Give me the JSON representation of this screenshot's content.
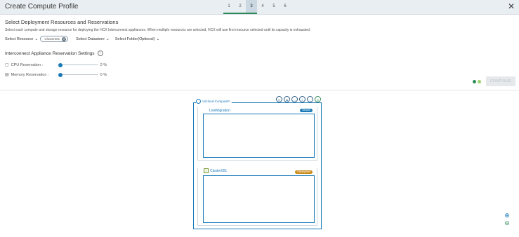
{
  "header": {
    "title": "Create Compute Profile",
    "steps": [
      "1",
      "2",
      "3",
      "4",
      "5",
      "6"
    ],
    "active_step": "3",
    "close_icon": "close-icon"
  },
  "main": {
    "section_title": "Select Deployment Resources and Reservations",
    "description": "Select each compute and storage resource for deploying the HCX Interconnect appliances. When multiple resources are selected, HCX will use first resource selected until its capacity is exhausted.",
    "select_resource_label": "Select Resource",
    "resource_pill": "Cluster001",
    "select_datastore_label": "Select Datastore",
    "select_folder_label": "Select Folder(Optional)"
  },
  "reservation": {
    "title": "Interconnect Appliance Reservation Settings",
    "cpu_label": "CPU Reservation :",
    "cpu_value": "0 %",
    "cpu_level": 0,
    "memory_label": "Memory Reservation :",
    "memory_value": "0 %",
    "memory_level": 0
  },
  "actions": {
    "continue_label": "CONTINUE",
    "dot_colors": [
      "#2e8b57",
      "#9bd16b"
    ]
  },
  "diagram": {
    "compute_label": "Vdcloud-ComputeP...",
    "top_label": "LiveMigration",
    "top_badge": "Service",
    "top_badge_color": "#1a7ab8",
    "cluster_label": "Cluster001",
    "cluster_badge": "Deployment",
    "cluster_badge_color": "#c98a1a",
    "service_icons": [
      "⎔",
      "⇆",
      "↔",
      "≡",
      "◌",
      "◎"
    ]
  },
  "zoom": {
    "in_label": "⊕",
    "out_label": "⊖"
  },
  "colors": {
    "accent": "#1a7ab8",
    "step_done": "#2e8b57",
    "header_bg": "#e9eef2"
  }
}
